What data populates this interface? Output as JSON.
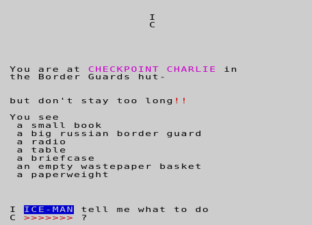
{
  "colors": {
    "background": "#cdcdcd",
    "text": "#000000",
    "highlight_location": "#c800c8",
    "warning": "#cd0000",
    "inverse_bg": "#0000cd",
    "inverse_fg": "#cdcdcd"
  },
  "header": {
    "line1": "I",
    "line2": "C"
  },
  "location": {
    "prefix": "You are at ",
    "name": "CHECKPOINT CHARLIE",
    "suffix": " in",
    "line2": "the Border Guards hut-"
  },
  "warning": {
    "text": "but don't stay too long",
    "exclaim": "!!"
  },
  "items_heading": "You see",
  "items": [
    " a small book",
    " a big russian border guard",
    " a radio",
    " a table",
    " a briefcase",
    " an empty wastepaper basket",
    " a paperweight"
  ],
  "prompt": {
    "prefix": "I ",
    "name": "ICE-MAN",
    "text": " tell me what to do",
    "input_prefix": "C ",
    "input_arrows": ">>>>>>>",
    "input_suffix": " ?"
  }
}
